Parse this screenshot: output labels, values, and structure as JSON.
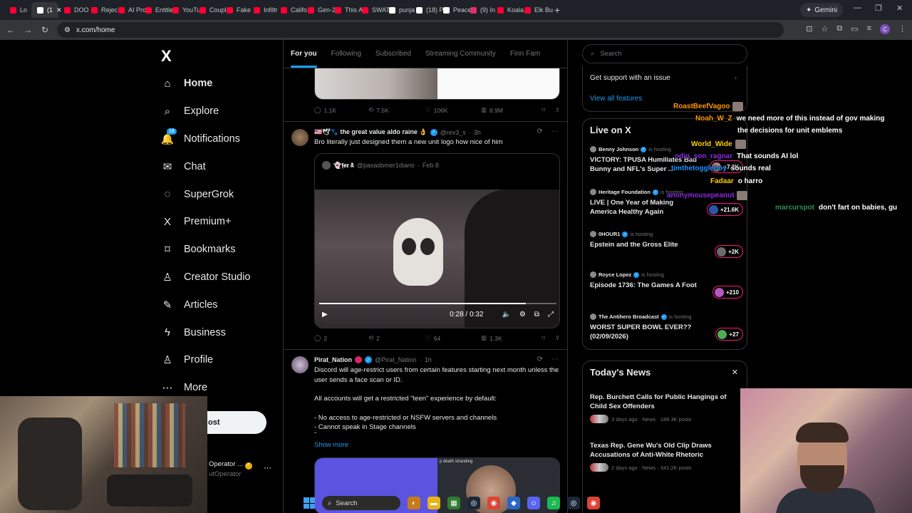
{
  "browser": {
    "tabs": [
      {
        "label": "Lo",
        "color": "#ff0033"
      },
      {
        "label": "(1",
        "color": "#ffffff",
        "active": true
      },
      {
        "label": "DOO",
        "color": "#ff0033"
      },
      {
        "label": "Rejec",
        "color": "#ff0033"
      },
      {
        "label": "AI Pro",
        "color": "#ff0033"
      },
      {
        "label": "Entitle",
        "color": "#ff0033"
      },
      {
        "label": "YouTu",
        "color": "#ff0033"
      },
      {
        "label": "Coupl",
        "color": "#ff0033"
      },
      {
        "label": "Fake",
        "color": "#ff0033"
      },
      {
        "label": "Infiltr",
        "color": "#ff0033"
      },
      {
        "label": "Califo",
        "color": "#ff0033"
      },
      {
        "label": "Gen-2",
        "color": "#ff0033"
      },
      {
        "label": "This A",
        "color": "#ff0033"
      },
      {
        "label": "SWAT",
        "color": "#ff0033"
      },
      {
        "label": "punja",
        "color": "#ffffff"
      },
      {
        "label": "(18) P",
        "color": "#ffffff"
      },
      {
        "label": "Peace",
        "color": "#ffffff"
      },
      {
        "label": "(9) In",
        "color": "#e1306c"
      },
      {
        "label": "Koala",
        "color": "#ff0033"
      },
      {
        "label": "Elk Bu",
        "color": "#ff0033"
      }
    ],
    "gemini_label": "Gemini",
    "url": "x.com/home"
  },
  "sidebar": {
    "logo": "X",
    "items": [
      {
        "label": "Home",
        "icon": "home-icon",
        "glyph": "⌂"
      },
      {
        "label": "Explore",
        "icon": "search-icon",
        "glyph": "⌕"
      },
      {
        "label": "Notifications",
        "icon": "bell-icon",
        "glyph": "🔔",
        "badge": "18"
      },
      {
        "label": "Chat",
        "icon": "envelope-icon",
        "glyph": "✉"
      },
      {
        "label": "SuperGrok",
        "icon": "grok-icon",
        "glyph": "◌"
      },
      {
        "label": "Premium+",
        "icon": "x-icon",
        "glyph": "X"
      },
      {
        "label": "Bookmarks",
        "icon": "bookmark-icon",
        "glyph": "⌑"
      },
      {
        "label": "Creator Studio",
        "icon": "creator-icon",
        "glyph": "♙"
      },
      {
        "label": "Articles",
        "icon": "article-icon",
        "glyph": "✎"
      },
      {
        "label": "Business",
        "icon": "lightning-icon",
        "glyph": "ϟ"
      },
      {
        "label": "Profile",
        "icon": "person-icon",
        "glyph": "♙"
      },
      {
        "label": "More",
        "icon": "more-icon",
        "glyph": "⋯"
      }
    ],
    "post_label": "ost",
    "account_name": "Operator ...",
    "account_handle": "utOperator"
  },
  "feed": {
    "tabs": [
      "For you",
      "Following",
      "Subscribed",
      "Streaming Community",
      "Finn Fam"
    ],
    "tweet1_actions": {
      "replies": "1.1K",
      "reposts": "7.5K",
      "likes": "106K",
      "views": "8.9M"
    },
    "tweet2": {
      "name": "🇺🇸🕊🐾 the great value aldo raine 👌",
      "handle": "@rev3_s",
      "time": "3h",
      "text": "Bro literally just designed them a new unit logo how nice of him",
      "quote_name": "👻𝖋𝖊𝖗 ☠",
      "quote_handle": "@pasadomer1diano",
      "quote_date": "Feb 8",
      "video_time": "0:28 / 0:32",
      "video_progress": 0.87,
      "replies": "2",
      "reposts": "2",
      "likes": "64",
      "views": "1.3K"
    },
    "tweet3": {
      "name": "Pirat_Nation",
      "handle": "@Pirat_Nation",
      "time": "1h",
      "text_1": "Discord will age-restrict users from certain features starting next month unless the user sends a face scan or ID.",
      "text_2": "All accounts will get a restricted \"teen\" experience by default:",
      "text_3": "- No access to age-restricted or NSFW servers and channels",
      "text_4": "- Cannot speak in Stage channels",
      "text_5": "-",
      "show_more": "Show more",
      "media_caption": "p death stranding"
    }
  },
  "right": {
    "search_placeholder": "Search",
    "support_label": "Get support with an issue",
    "view_all_label": "View all features",
    "live_title": "Live on X",
    "live_items": [
      {
        "host": "Benny Johnson",
        "status": "is hosting",
        "title": "VICTORY: TPUSA Humiliates Bad Bunny and NFL's Super ...",
        "count": "+7.3K"
      },
      {
        "host": "Heritage Foundation",
        "status": "is hosting",
        "title": "LIVE | One Year of Making America Healthy Again",
        "count": "+21.6K"
      },
      {
        "host": "0HOUR1",
        "status": "is hosting",
        "title": "Epstein and the Gross Elite",
        "count": "+2K"
      },
      {
        "host": "Royce Lopez",
        "status": "is hosting",
        "title": "Episode 1736: The Games A Foot",
        "count": "+210"
      },
      {
        "host": "The Antihero Broadcast",
        "status": "is hosting",
        "title": "WORST SUPER BOWL EVER?? (02/09/2026)",
        "count": "+27"
      }
    ],
    "news_title": "Today's News",
    "news_items": [
      {
        "title": "Rep. Burchett Calls for Public Hangings of Child Sex Offenders",
        "meta": "3 days ago · News · 188.3K posts"
      },
      {
        "title": "Texas Rep. Gene Wu's Old Clip Draws Accusations of Anti-White Rhetoric",
        "meta": "2 days ago · News · 341.2K posts"
      }
    ]
  },
  "chat": [
    {
      "user": "RoastBeefVagoo",
      "color": "#ff9900",
      "msg": ""
    },
    {
      "user": "Noah_W_Z",
      "color": "#ff9900",
      "msg": "we need more of this instead of gov making"
    },
    {
      "user": "",
      "color": "#ffffff",
      "msg": "the decisions for unit emblems"
    },
    {
      "user": "World_Wide",
      "color": "#ffcc00",
      "msg": ""
    },
    {
      "user": "odin_son_ragnar",
      "color": "#8a2be2",
      "msg": "That sounds AI lol"
    },
    {
      "user": "timthetoggleboy",
      "color": "#1e90ff",
      "msg": "sounds real"
    },
    {
      "user": "Fadaar",
      "color": "#ffcc00",
      "msg": "o harro"
    },
    {
      "user": "anonymousepeanut",
      "color": "#8a2be2",
      "msg": ""
    },
    {
      "user": "marcurspot",
      "color": "#2e8b57",
      "msg": "don't fart on babies, gu"
    }
  ],
  "taskbar": {
    "search_label": "Search"
  }
}
